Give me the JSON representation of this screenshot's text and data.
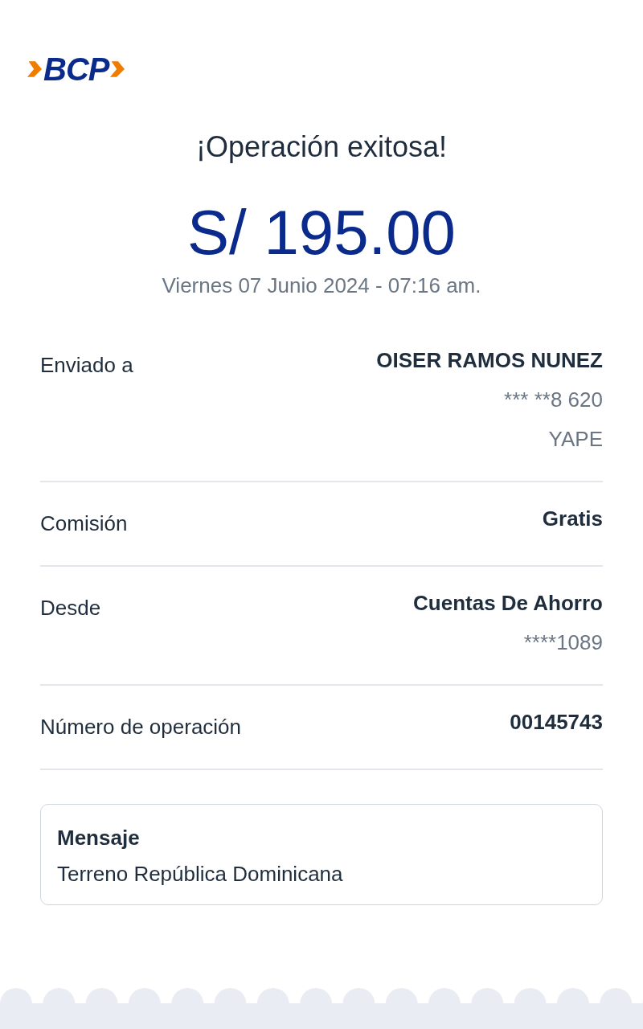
{
  "logo": {
    "text": "BCP"
  },
  "title": "¡Operación exitosa!",
  "amount": "S/ 195.00",
  "datetime": "Viernes 07 Junio 2024 - 07:16 am.",
  "details": [
    {
      "label": "Enviado a",
      "values": [
        {
          "text": "OISER RAMOS NUNEZ",
          "kind": "primary"
        },
        {
          "text": "*** **8 620",
          "kind": "secondary"
        },
        {
          "text": "YAPE",
          "kind": "secondary"
        }
      ]
    },
    {
      "label": "Comisión",
      "values": [
        {
          "text": "Gratis",
          "kind": "primary"
        }
      ]
    },
    {
      "label": "Desde",
      "values": [
        {
          "text": "Cuentas De Ahorro",
          "kind": "primary"
        },
        {
          "text": "****1089",
          "kind": "secondary"
        }
      ]
    },
    {
      "label": "Número de operación",
      "values": [
        {
          "text": "00145743",
          "kind": "primary"
        }
      ]
    }
  ],
  "message": {
    "title": "Mensaje",
    "text": "Terreno República Dominicana"
  }
}
